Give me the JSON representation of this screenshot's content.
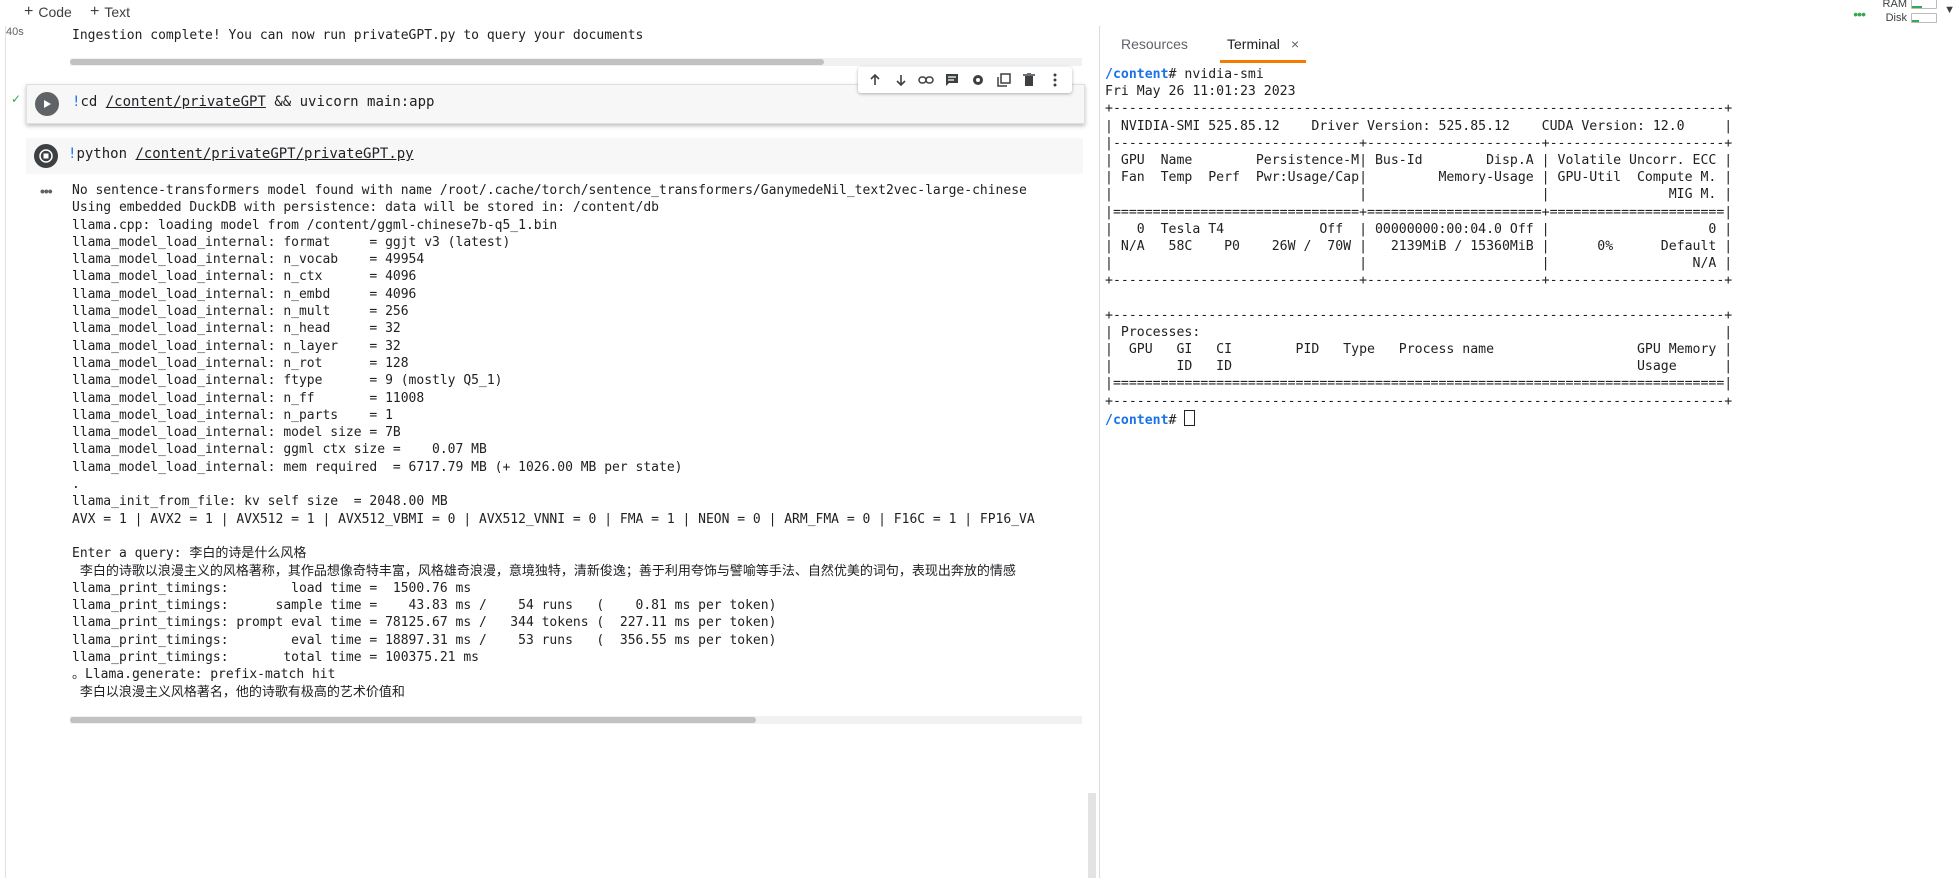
{
  "toolbar": {
    "code_label": "Code",
    "text_label": "Text",
    "ram_label": "RAM",
    "disk_label": "Disk"
  },
  "notebook": {
    "exec_time": "40s",
    "ingest_line": "Ingestion complete! You can now run privateGPT.py to query your documents",
    "cell1": {
      "bang": "!",
      "cmd": "cd ",
      "path": "/content/privateGPT",
      "rest": " && uvicorn main:app"
    },
    "cell2": {
      "bang": "!",
      "cmd": "python ",
      "path": "/content/privateGPT/privateGPT.py"
    },
    "output_lines": [
      "No sentence-transformers model found with name /root/.cache/torch/sentence_transformers/GanymedeNil_text2vec-large-chinese",
      "Using embedded DuckDB with persistence: data will be stored in: /content/db",
      "llama.cpp: loading model from /content/ggml-chinese7b-q5_1.bin",
      "llama_model_load_internal: format     = ggjt v3 (latest)",
      "llama_model_load_internal: n_vocab    = 49954",
      "llama_model_load_internal: n_ctx      = 4096",
      "llama_model_load_internal: n_embd     = 4096",
      "llama_model_load_internal: n_mult     = 256",
      "llama_model_load_internal: n_head     = 32",
      "llama_model_load_internal: n_layer    = 32",
      "llama_model_load_internal: n_rot      = 128",
      "llama_model_load_internal: ftype      = 9 (mostly Q5_1)",
      "llama_model_load_internal: n_ff       = 11008",
      "llama_model_load_internal: n_parts    = 1",
      "llama_model_load_internal: model size = 7B",
      "llama_model_load_internal: ggml ctx size =    0.07 MB",
      "llama_model_load_internal: mem required  = 6717.79 MB (+ 1026.00 MB per state)",
      ".",
      "llama_init_from_file: kv self size  = 2048.00 MB",
      "AVX = 1 | AVX2 = 1 | AVX512 = 1 | AVX512_VBMI = 0 | AVX512_VNNI = 0 | FMA = 1 | NEON = 0 | ARM_FMA = 0 | F16C = 1 | FP16_VA",
      "",
      "Enter a query: 李白的诗是什么风格",
      " 李白的诗歌以浪漫主义的风格著称，其作品想像奇特丰富，风格雄奇浪漫，意境独特，清新俊逸；善于利用夸饰与譬喻等手法、自然优美的词句，表现出奔放的情感",
      "llama_print_timings:        load time =  1500.76 ms",
      "llama_print_timings:      sample time =    43.83 ms /    54 runs   (    0.81 ms per token)",
      "llama_print_timings: prompt eval time = 78125.67 ms /   344 tokens (  227.11 ms per token)",
      "llama_print_timings:        eval time = 18897.31 ms /    53 runs   (  356.55 ms per token)",
      "llama_print_timings:       total time = 100375.21 ms",
      "。Llama.generate: prefix-match hit",
      " 李白以浪漫主义风格著名，他的诗歌有极高的艺术价值和"
    ]
  },
  "panel": {
    "tab_resources": "Resources",
    "tab_terminal": "Terminal",
    "close_symbol": "×",
    "terminal_lines": [
      {
        "prompt": "/content",
        "text": "# nvidia-smi"
      },
      {
        "prompt": "",
        "text": "Fri May 26 11:01:23 2023"
      },
      {
        "prompt": "",
        "text": "+-----------------------------------------------------------------------------+"
      },
      {
        "prompt": "",
        "text": "| NVIDIA-SMI 525.85.12    Driver Version: 525.85.12    CUDA Version: 12.0     |"
      },
      {
        "prompt": "",
        "text": "|-------------------------------+----------------------+----------------------+"
      },
      {
        "prompt": "",
        "text": "| GPU  Name        Persistence-M| Bus-Id        Disp.A | Volatile Uncorr. ECC |"
      },
      {
        "prompt": "",
        "text": "| Fan  Temp  Perf  Pwr:Usage/Cap|         Memory-Usage | GPU-Util  Compute M. |"
      },
      {
        "prompt": "",
        "text": "|                               |                      |               MIG M. |"
      },
      {
        "prompt": "",
        "text": "|===============================+======================+======================|"
      },
      {
        "prompt": "",
        "text": "|   0  Tesla T4            Off  | 00000000:00:04.0 Off |                    0 |"
      },
      {
        "prompt": "",
        "text": "| N/A   58C    P0    26W /  70W |   2139MiB / 15360MiB |      0%      Default |"
      },
      {
        "prompt": "",
        "text": "|                               |                      |                  N/A |"
      },
      {
        "prompt": "",
        "text": "+-------------------------------+----------------------+----------------------+"
      },
      {
        "prompt": "",
        "text": ""
      },
      {
        "prompt": "",
        "text": "+-----------------------------------------------------------------------------+"
      },
      {
        "prompt": "",
        "text": "| Processes:                                                                  |"
      },
      {
        "prompt": "",
        "text": "|  GPU   GI   CI        PID   Type   Process name                  GPU Memory |"
      },
      {
        "prompt": "",
        "text": "|        ID   ID                                                   Usage      |"
      },
      {
        "prompt": "",
        "text": "|=============================================================================|"
      },
      {
        "prompt": "",
        "text": "+-----------------------------------------------------------------------------+"
      },
      {
        "prompt": "/content",
        "text": "# "
      }
    ]
  }
}
